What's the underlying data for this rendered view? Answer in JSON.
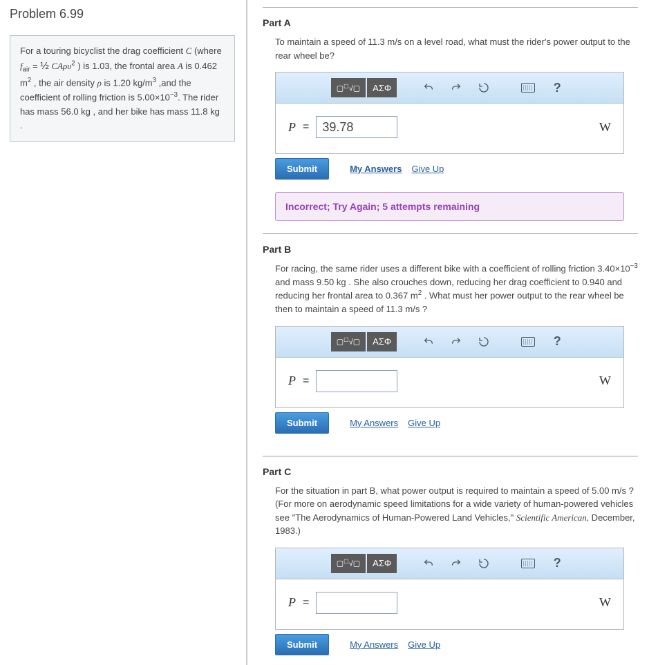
{
  "title": "Problem 6.99",
  "problem_text_html": "For a touring bicyclist the drag coefficient <span class='ital'>C</span> (where <span class='ital'>f</span><sub>air</sub> = <span style='font-size:15px'>&frac12;</span> <span class='ital'>CA&rho;&upsilon;</span><sup>2</sup> ) is 1.03, the frontal area <span class='ital'>A</span> is 0.462 m<sup>2</sup> , the air density <span class='ital'>&rho;</span> is 1.20 kg/m<sup>3</sup> ,and the coefficient of rolling friction is 5.00&times;10<sup>&minus;3</sup>. The rider has mass 56.0 kg , and her bike has mass 11.8 kg .",
  "toolbar": {
    "templates_icon": "▢√▢",
    "greek_icon": "ΑΣΦ",
    "undo_icon": "↶",
    "redo_icon": "↷",
    "reset_icon": "↻",
    "keyboard_icon": "kbd",
    "help_icon": "?"
  },
  "actions": {
    "submit": "Submit",
    "my_answers": "My Answers",
    "give_up": "Give Up"
  },
  "parts": [
    {
      "id": "A",
      "title": "Part A",
      "prompt_html": "To maintain a speed of 11.3 m/s on a level road, what must the rider's power output to the rear wheel be?",
      "variable": "P",
      "value": "39.78",
      "unit": "W",
      "feedback": "Incorrect; Try Again; 5 attempts remaining",
      "my_answers_bold": true
    },
    {
      "id": "B",
      "title": "Part B",
      "prompt_html": "For racing, the same rider uses a different bike with a coefficient of rolling friction 3.40&times;10<sup>&minus;3</sup> and mass 9.50 kg . She also crouches down, reducing her drag coefficient to 0.940 and reducing her frontal area to 0.367 m<sup>2</sup> . What must her power output to the rear wheel be then to maintain a speed of 11.3 m/s ?",
      "variable": "P",
      "value": "",
      "unit": "W",
      "feedback": null,
      "my_answers_bold": false
    },
    {
      "id": "C",
      "title": "Part C",
      "prompt_html": "For the situation in part B, what power output is required to maintain a speed of 5.00 m/s ? (For more on aerodynamic speed limitations for a wide variety of human-powered vehicles see &quot;The Aerodynamics of Human-Powered Land Vehicles,&quot; <span class='ital'>Scientific American,</span> December, 1983.)",
      "variable": "P",
      "value": "",
      "unit": "W",
      "feedback": null,
      "my_answers_bold": false
    }
  ]
}
